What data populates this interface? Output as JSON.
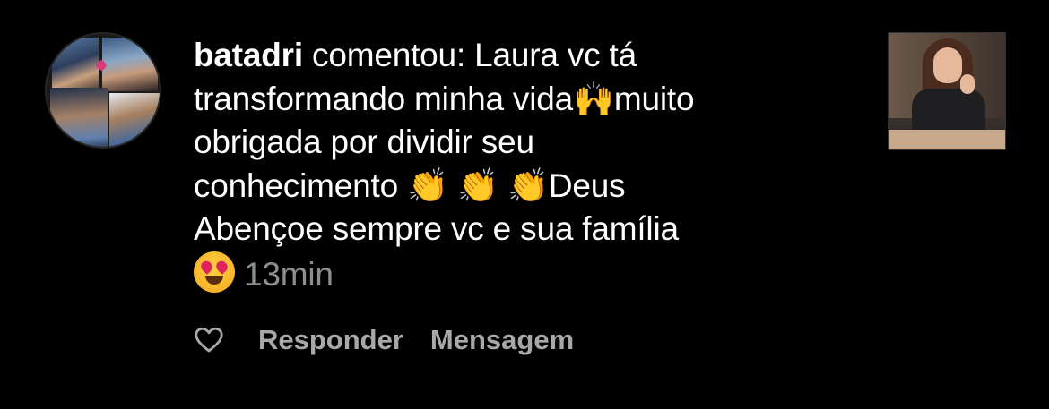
{
  "comment": {
    "username": "batadri",
    "text_line1": " comentou: Laura vc tá",
    "text_line2a": "transformando minha vida",
    "emoji_raised_hands": "🙌",
    "text_line2b": "muito",
    "text_line3": "obrigada por dividir seu",
    "text_line4a": "conhecimento ",
    "emoji_clap": "👏",
    "text_line4b": "Deus",
    "text_line5": "Abençoe sempre vc e sua família",
    "emoji_heart_eyes": "😍",
    "timestamp": "13min"
  },
  "actions": {
    "like_icon": "heart-outline-icon",
    "reply_label": "Responder",
    "message_label": "Mensagem"
  },
  "colors": {
    "background": "#000000",
    "text": "#ffffff",
    "muted": "#8e8e8e",
    "action": "#a8a8a8"
  }
}
